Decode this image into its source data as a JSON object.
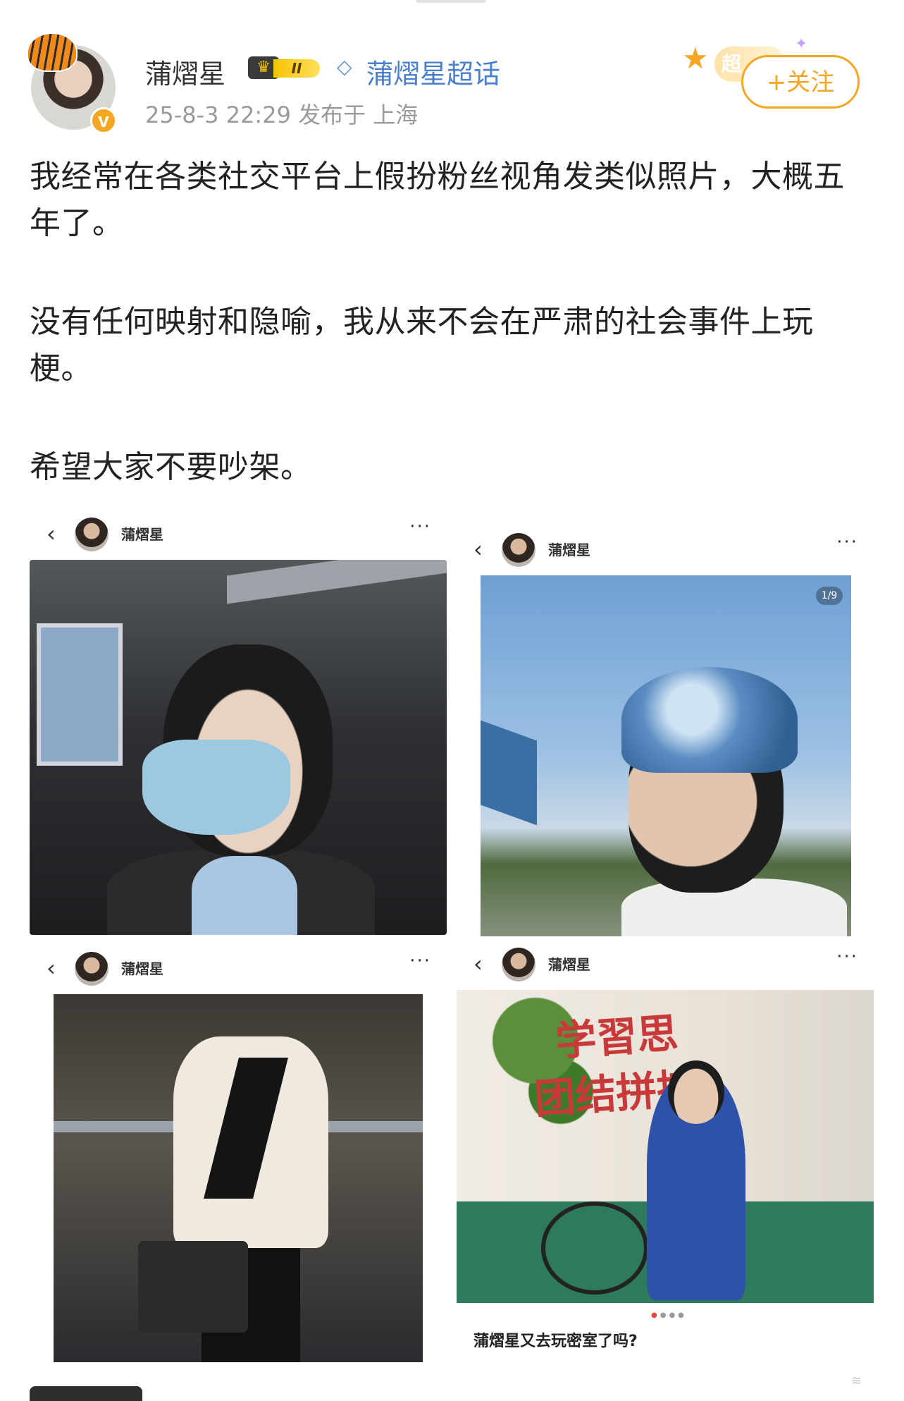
{
  "post": {
    "author": "蒲熠星",
    "level_badge": "II",
    "topic": "蒲熠星超话",
    "meta": "25-8-3 22:29  发布于 上海",
    "verified_mark": "V",
    "chao_label": "超",
    "follow_label": "+关注",
    "paragraphs": [
      "我经常在各类社交平台上假扮粉丝视角发类似照片，大概五年了。",
      "没有任何映射和隐喻，我从来不会在严肃的社会事件上玩梗。",
      "希望大家不要吵架。"
    ]
  },
  "screenshots": [
    {
      "back": "‹",
      "name": "蒲熠星",
      "more": "···"
    },
    {
      "back": "‹",
      "name": "蒲熠星",
      "more": "···",
      "pager": "1/9"
    },
    {
      "back": "‹",
      "name": "蒲熠星",
      "more": "···"
    },
    {
      "back": "‹",
      "name": "蒲熠星",
      "more": "···",
      "wall_text": [
        "学習思",
        "团结拼搏"
      ],
      "caption": "蒲熠星又去玩密室了吗?"
    }
  ],
  "colors": {
    "accent": "#f5a623",
    "topic_blue": "#4a7fcc",
    "meta_gray": "#9a9a9a"
  },
  "icons": [
    "tiger-avatar-icon",
    "crown-badge-icon",
    "diamond-icon",
    "star-icon",
    "back-chevron-icon",
    "more-dots-icon"
  ]
}
